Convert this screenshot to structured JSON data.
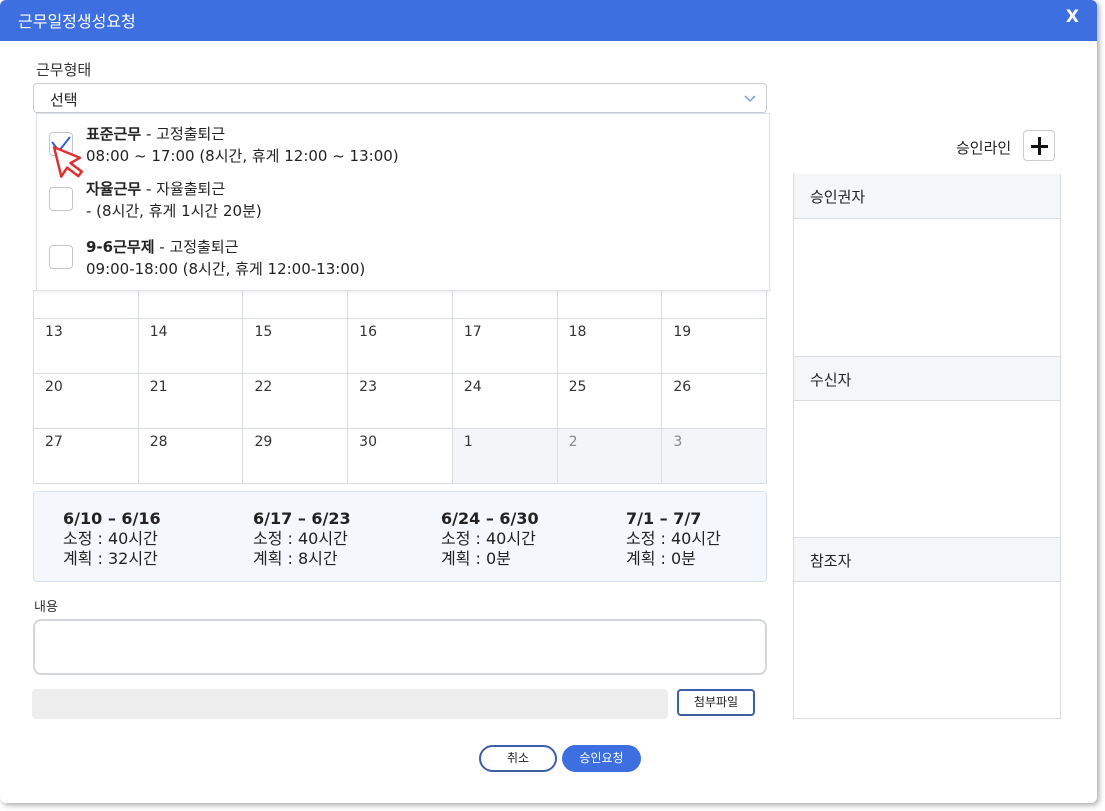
{
  "dialog": {
    "title": "근무일정생성요청",
    "close_label": "X"
  },
  "work_type": {
    "label": "근무형태",
    "selected": "선택",
    "options": [
      {
        "name": "표준근무",
        "type": " - 고정출퇴근",
        "detail": "08:00 ~ 17:00 (8시간, 휴게 12:00 ~ 13:00)",
        "checked": true
      },
      {
        "name": "자율근무",
        "type": " - 자율출퇴근",
        "detail": "- (8시간, 휴게 1시간 20분)",
        "checked": false
      },
      {
        "name": "9-6근무제",
        "type": " - 고정출퇴근",
        "detail": "09:00-18:00 (8시간, 휴게 12:00-13:00)",
        "checked": false
      }
    ]
  },
  "calendar": {
    "rows": [
      [
        "",
        "",
        "",
        "",
        "",
        "",
        ""
      ],
      [
        "13",
        "14",
        "15",
        "16",
        "17",
        "18",
        "19"
      ],
      [
        "20",
        "21",
        "22",
        "23",
        "24",
        "25",
        "26"
      ],
      [
        "27",
        "28",
        "29",
        "30",
        "1",
        "2",
        "3"
      ]
    ]
  },
  "weekly_summary": [
    {
      "range": "6/10 – 6/16",
      "standard": "소정 : 40시간",
      "planned": "계획 : 32시간"
    },
    {
      "range": "6/17 – 6/23",
      "standard": "소정 : 40시간",
      "planned": "계획 : 8시간"
    },
    {
      "range": "6/24 – 6/30",
      "standard": "소정 : 40시간",
      "planned": "계획 : 0분"
    },
    {
      "range": "7/1 – 7/7",
      "standard": "소정 : 40시간",
      "planned": "계획 : 0분"
    }
  ],
  "content": {
    "label": "내용",
    "value": ""
  },
  "attach": {
    "button_label": "첨부파일"
  },
  "actions": {
    "cancel_label": "취소",
    "approve_label": "승인요청"
  },
  "approval": {
    "line_label": "승인라인",
    "sections": [
      "승인권자",
      "수신자",
      "참조자"
    ]
  },
  "colors": {
    "accent": "#3d6fe0",
    "check": "#2a63d8",
    "cursor": "#e03131"
  }
}
